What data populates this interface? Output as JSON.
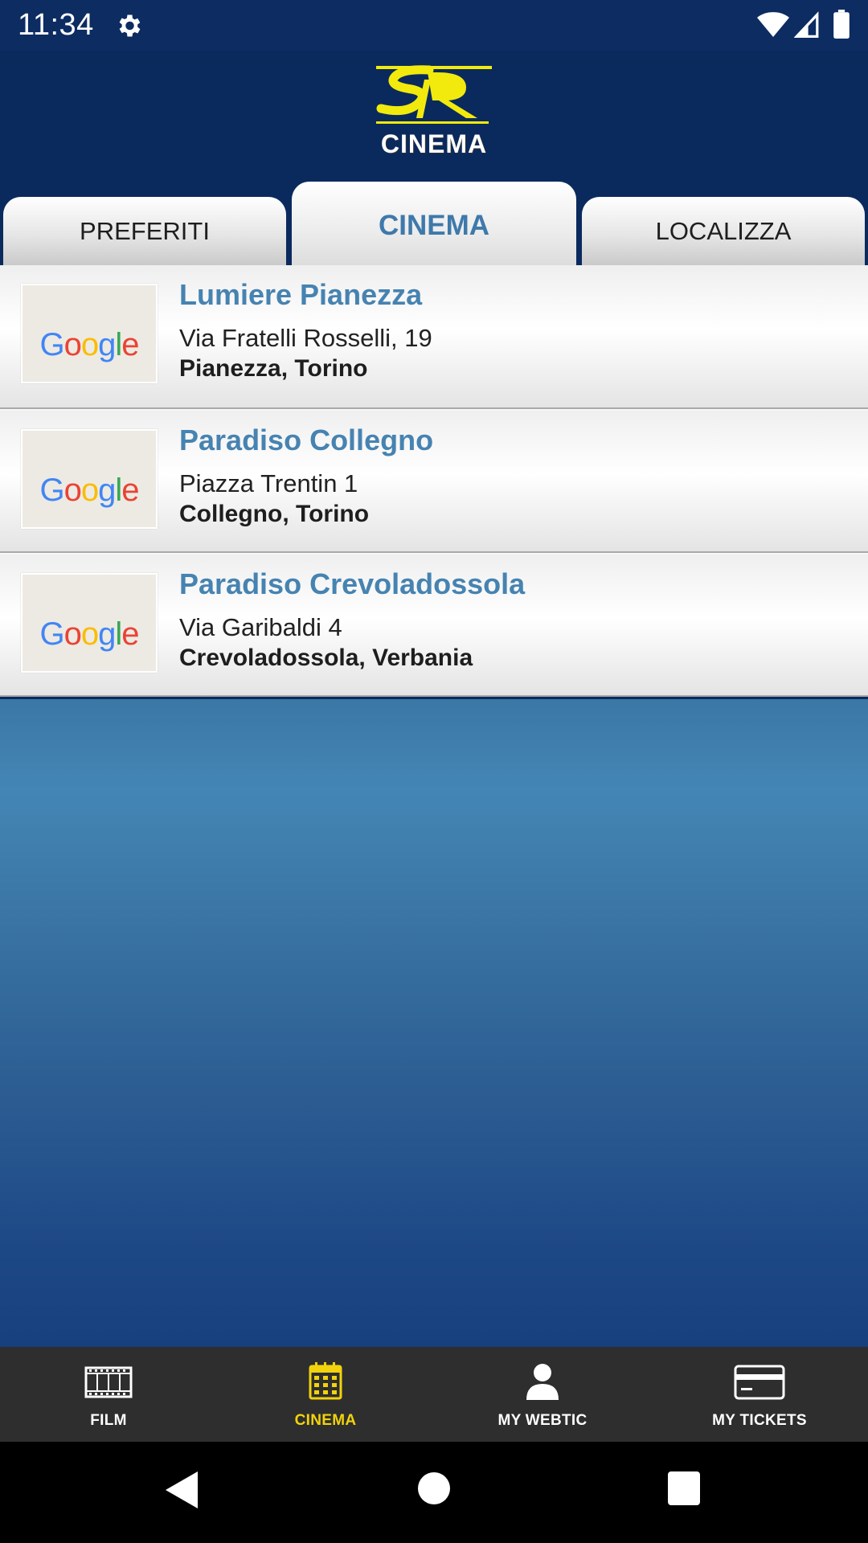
{
  "status_bar": {
    "time": "11:34",
    "icons": [
      "gear-icon",
      "wifi-icon",
      "signal-icon",
      "battery-icon"
    ]
  },
  "header": {
    "logo_text": "CINEMA",
    "logo_colors": {
      "monogram": "#f2ea0c",
      "background": "#0a2a5e"
    }
  },
  "tabs": [
    {
      "label": "PREFERITI",
      "active": false
    },
    {
      "label": "CINEMA",
      "active": true
    },
    {
      "label": "LOCALIZZA",
      "active": false
    }
  ],
  "cinemas": [
    {
      "name": "Lumiere Pianezza",
      "address": "Via Fratelli Rosselli, 19",
      "city": "Pianezza, Torino",
      "thumb": "Google"
    },
    {
      "name": "Paradiso Collegno",
      "address": "Piazza Trentin 1",
      "city": "Collegno, Torino",
      "thumb": "Google"
    },
    {
      "name": "Paradiso Crevoladossola",
      "address": "Via Garibaldi 4",
      "city": "Crevoladossola, Verbania",
      "thumb": "Google"
    }
  ],
  "bottom_nav": [
    {
      "label": "FILM",
      "icon": "film-icon",
      "active": false
    },
    {
      "label": "CINEMA",
      "icon": "cinema-calendar-icon",
      "active": true
    },
    {
      "label": "MY WEBTIC",
      "icon": "user-icon",
      "active": false
    },
    {
      "label": "MY TICKETS",
      "icon": "card-icon",
      "active": false
    }
  ],
  "colors": {
    "accent_active_tab": "#3e79ab",
    "cinema_name": "#4683b1",
    "nav_active": "#f2d20c",
    "nav_bg": "#2e2e2e"
  }
}
